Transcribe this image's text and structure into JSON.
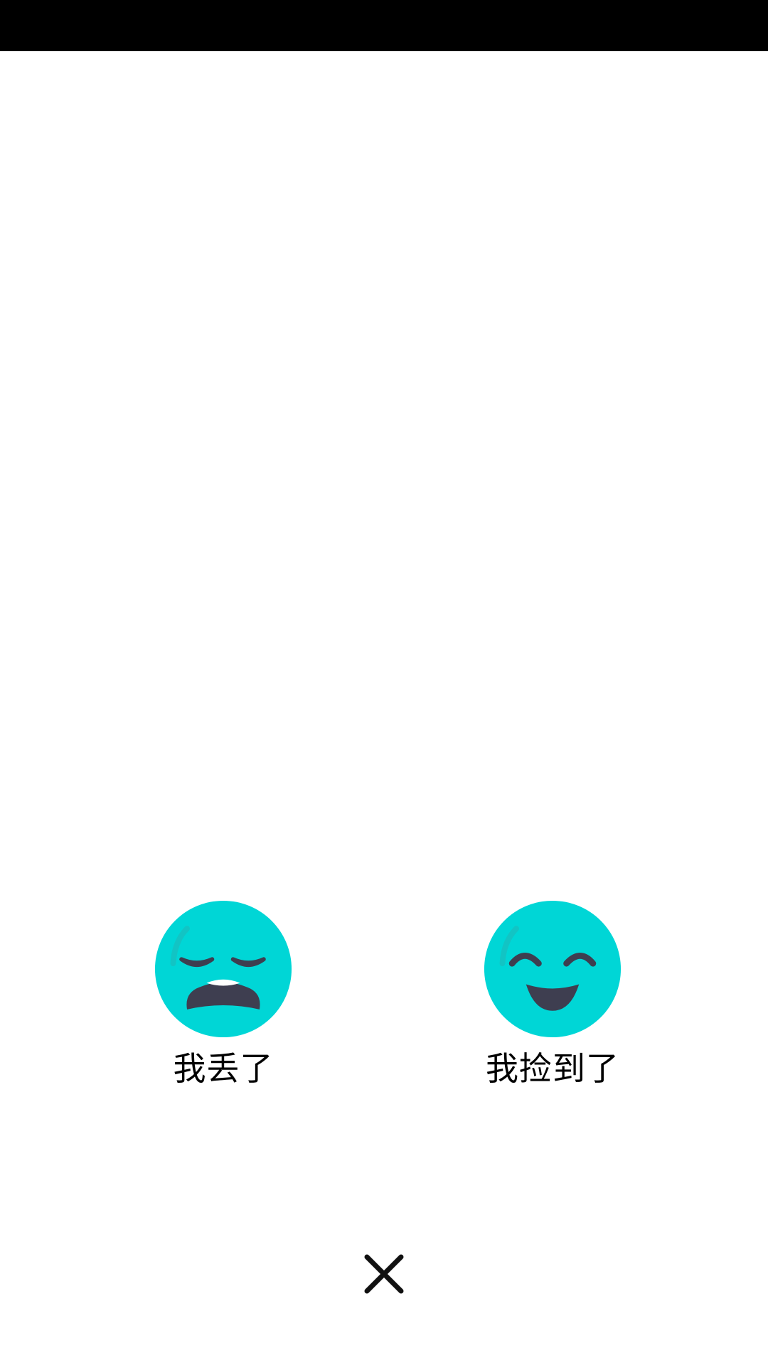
{
  "status_bar": {
    "background": "#000000"
  },
  "colors": {
    "face": "#00D6D6",
    "features": "#3E3E50",
    "teeth": "#FFFFFF",
    "close": "#111111"
  },
  "options": [
    {
      "label": "我丢了",
      "icon": "crying-face-icon"
    },
    {
      "label": "我捡到了",
      "icon": "smiling-face-icon"
    }
  ],
  "close_button": {
    "icon": "close-icon"
  }
}
